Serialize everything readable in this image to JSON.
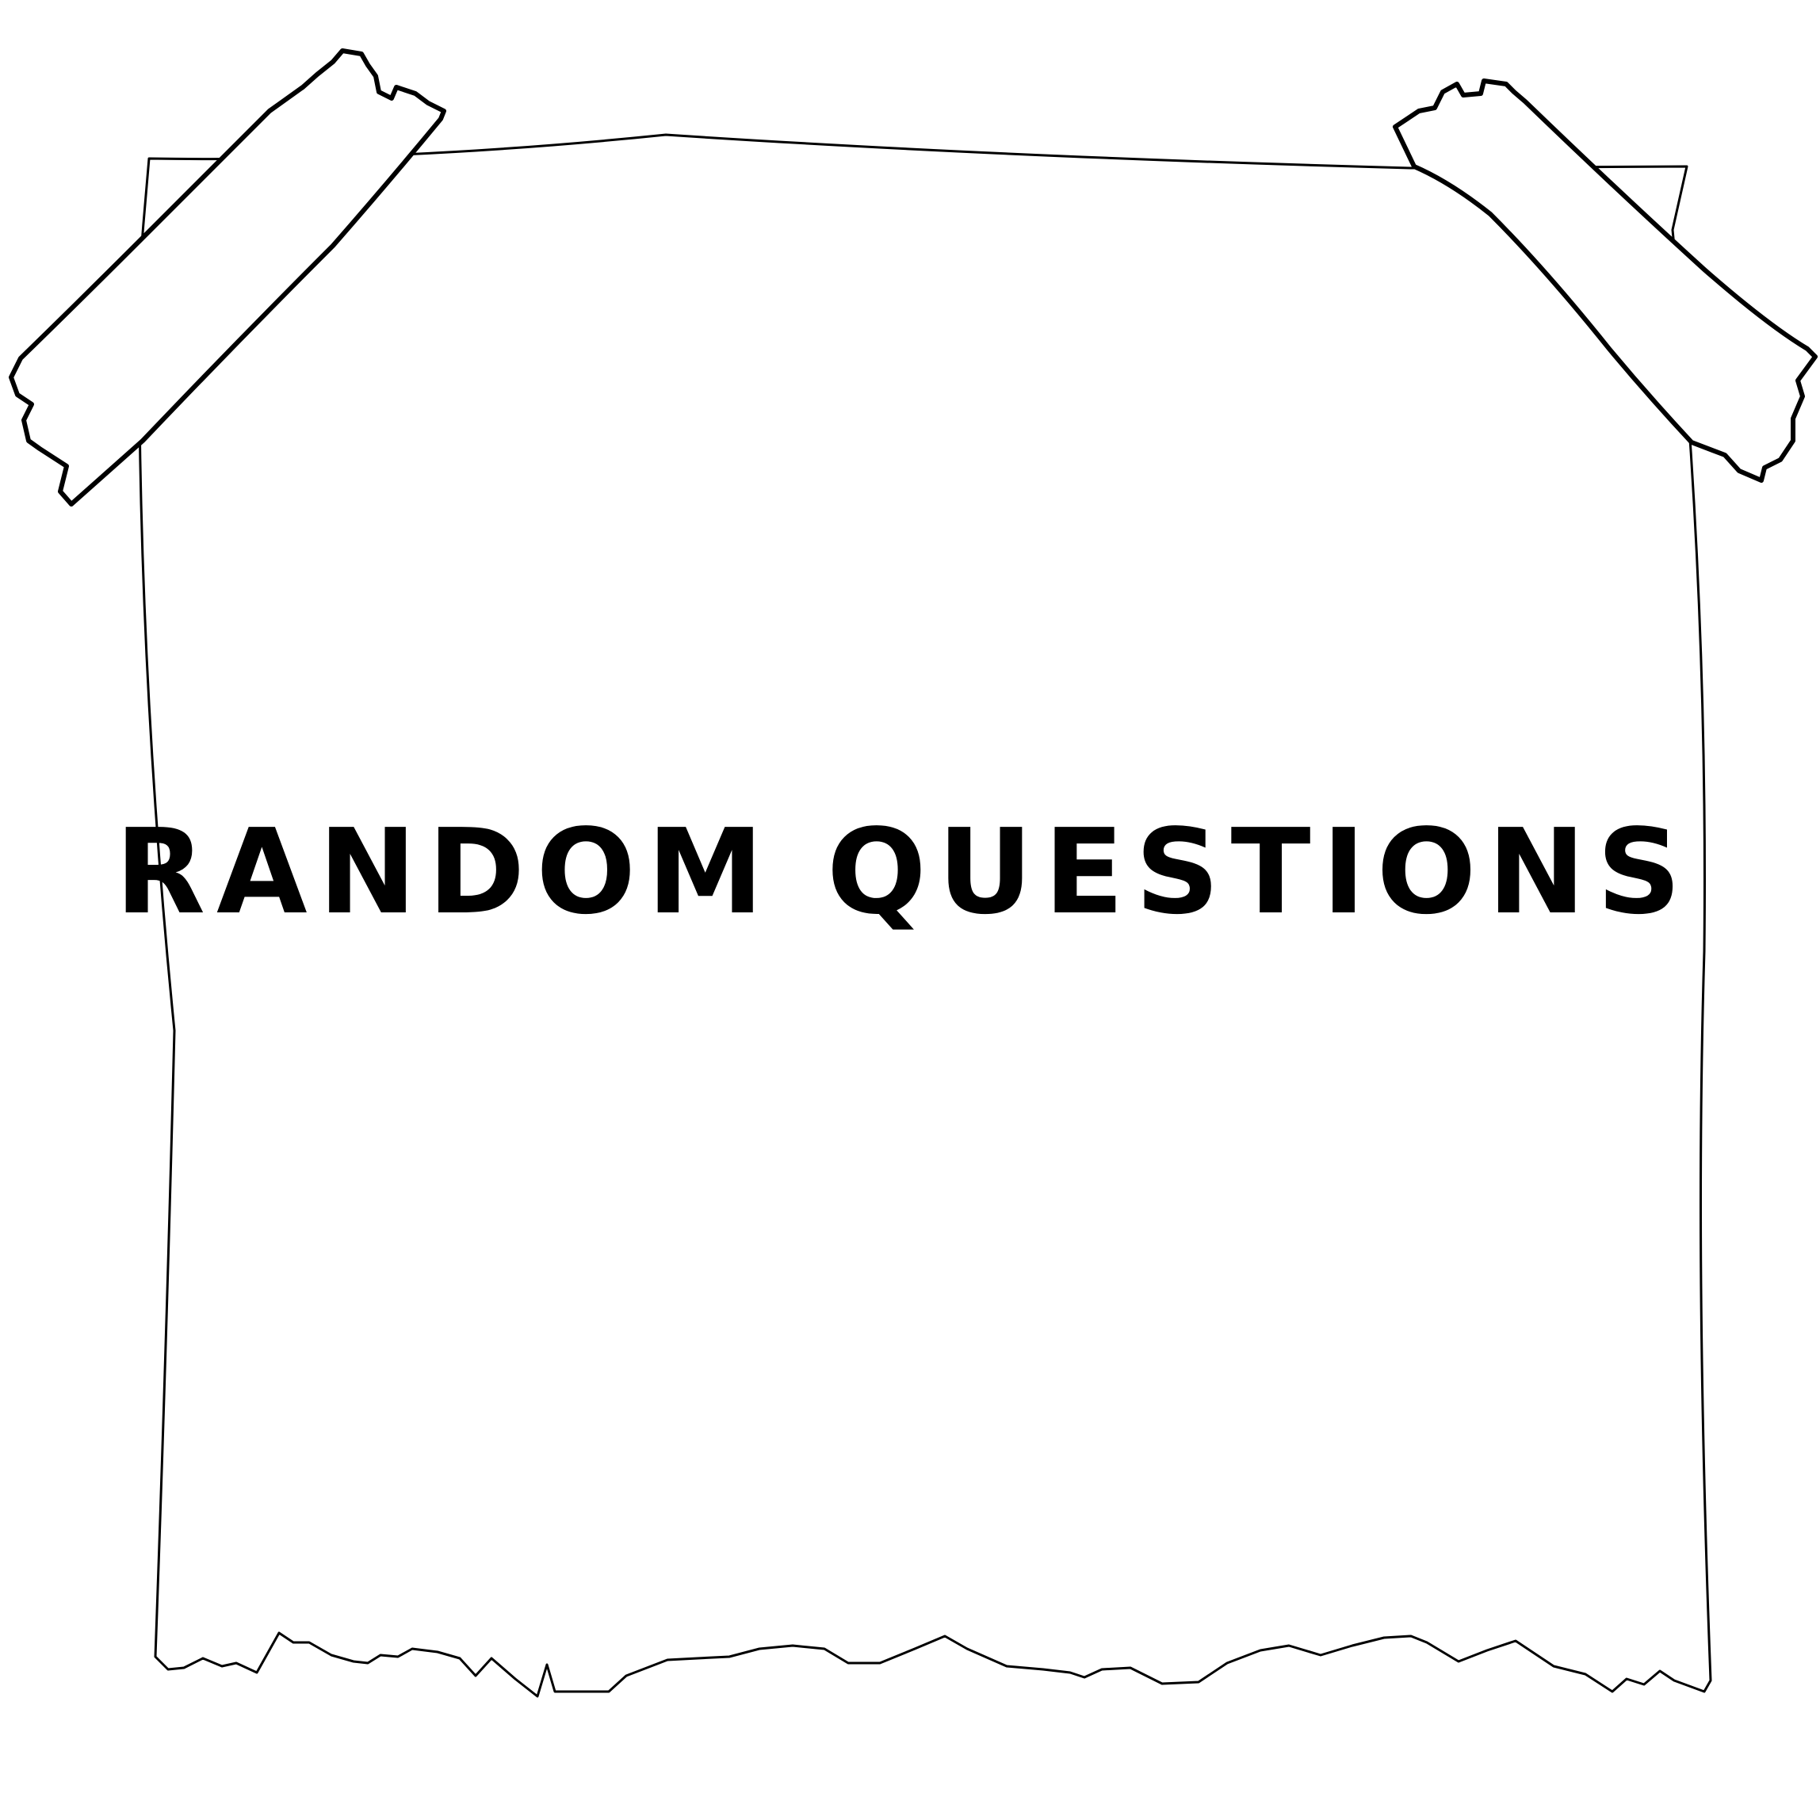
{
  "note": {
    "title": "RANDOM QUESTIONS"
  },
  "colors": {
    "background": "#ffffff",
    "paper": "#ffffff",
    "outline": "#000000",
    "text": "#000000"
  },
  "icons": {
    "left_tape": "tape-strip",
    "right_tape": "tape-strip"
  }
}
